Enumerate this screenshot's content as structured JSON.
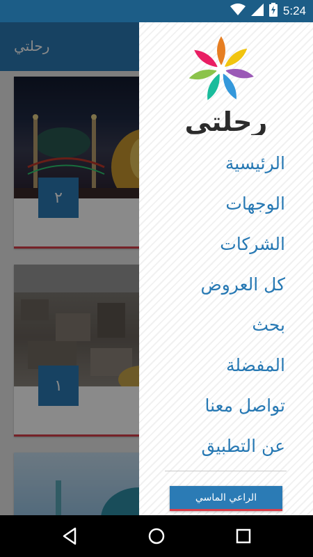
{
  "status_bar": {
    "time": "5:24",
    "icons": [
      "wifi-icon",
      "signal-icon",
      "battery-charging-icon"
    ]
  },
  "app_bar": {
    "title": "رحلتي"
  },
  "cards": [
    {
      "number": "٢"
    },
    {
      "number": "١"
    }
  ],
  "drawer": {
    "logo_text": "رحلتي",
    "menu": [
      {
        "label": "الرئيسية"
      },
      {
        "label": "الوجهات"
      },
      {
        "label": "الشركات"
      },
      {
        "label": "كل العروض"
      },
      {
        "label": "بحث"
      },
      {
        "label": "المفضلة"
      },
      {
        "label": "تواصل معنا"
      },
      {
        "label": "عن التطبيق"
      }
    ],
    "sponsor_label": "الراعي الماسي"
  },
  "colors": {
    "primary": "#2b7bb5",
    "status_bar": "#1c5d87",
    "accent": "#d9404a",
    "menu_text": "#2678b3"
  },
  "nav_bar": {
    "icons": [
      "back-icon",
      "home-icon",
      "recents-icon"
    ]
  }
}
